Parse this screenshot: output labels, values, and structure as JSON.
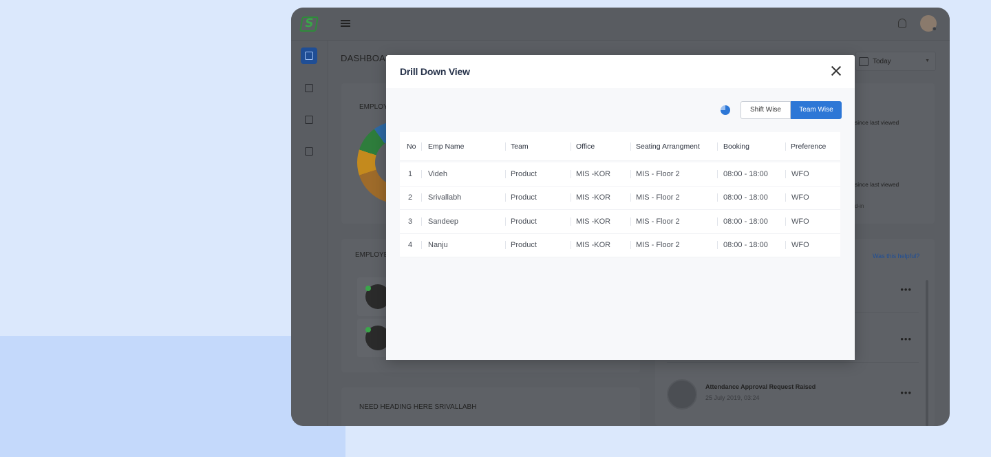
{
  "page": {
    "title": "DASHBOARD"
  },
  "date_filter": {
    "value": "Today"
  },
  "cards": {
    "employee_chart_label": "EMPLOY",
    "employees_label": "EMPLOYE",
    "bottom_heading": "NEED HEADING HERE SRIVALLABH",
    "right_hint_1": "since last viewed",
    "right_hint_2": "since last viewed",
    "right_hint_3": "d-in",
    "helpful_link": "Was this helpful?"
  },
  "notifications": [
    {
      "title": "Attendance Approval Request Raised",
      "date": "25 July 2019, 03:24"
    }
  ],
  "modal": {
    "title": "Drill Down View",
    "toggle": {
      "left": "Shift Wise",
      "right": "Team Wise",
      "active": "Team Wise"
    },
    "columns": [
      "No",
      "Emp Name",
      "Team",
      "Office",
      "Seating Arrangment",
      "Booking",
      "Preference"
    ],
    "rows": [
      [
        "1",
        "Videh",
        "Product",
        "MIS -KOR",
        "MIS - Floor 2",
        "08:00 - 18:00",
        "WFO"
      ],
      [
        "2",
        "Srivallabh",
        "Product",
        "MIS -KOR",
        "MIS - Floor 2",
        "08:00 - 18:00",
        "WFO"
      ],
      [
        "3",
        "Sandeep",
        "Product",
        "MIS -KOR",
        "MIS - Floor 2",
        "08:00 - 18:00",
        "WFO"
      ],
      [
        "4",
        "Nanju",
        "Product",
        "MIS -KOR",
        "MIS - Floor 2",
        "08:00 - 18:00",
        "WFO"
      ]
    ]
  },
  "colors": {
    "accent": "#2d77d6",
    "overlay": "#5b5e63",
    "brand_green": "#3aa64a"
  }
}
